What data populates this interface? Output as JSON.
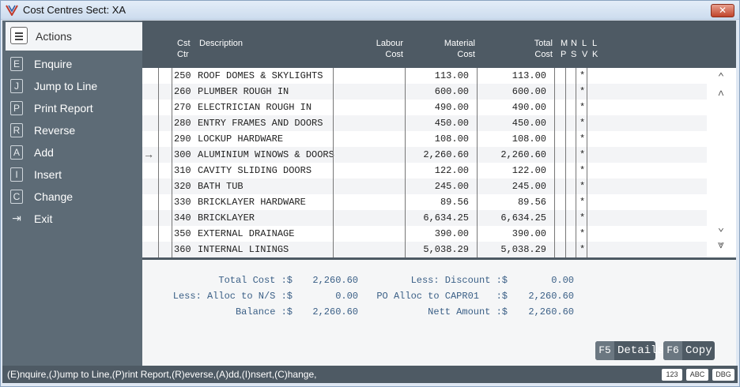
{
  "window": {
    "title": "Cost Centres  Sect: XA",
    "close_label": "✕"
  },
  "sidebar": {
    "title": "Actions",
    "items": [
      {
        "key": "E",
        "label": "Enquire"
      },
      {
        "key": "J",
        "label": "Jump to Line"
      },
      {
        "key": "P",
        "label": "Print Report"
      },
      {
        "key": "R",
        "label": "Reverse"
      },
      {
        "key": "A",
        "label": "Add"
      },
      {
        "key": "I",
        "label": "Insert"
      },
      {
        "key": "C",
        "label": "Change"
      },
      {
        "key": "⇥",
        "label": "Exit"
      }
    ]
  },
  "grid": {
    "headers": {
      "cst_ctr_1": "Cst",
      "cst_ctr_2": "Ctr",
      "description": "Description",
      "labour_1": "Labour",
      "labour_2": "Cost",
      "material_1": "Material",
      "material_2": "Cost",
      "total_1": "Total",
      "total_2": "Cost",
      "mp_1": "M",
      "mp_2": "P",
      "ns_1": "N",
      "ns_2": "S",
      "lv_1": "L",
      "lv_2": "V",
      "lk_1": "L",
      "lk_2": "K"
    },
    "rows": [
      {
        "ctr": "250",
        "desc": "ROOF DOMES & SKYLIGHTS",
        "labour": "",
        "material": "113.00",
        "total": "113.00",
        "lv": "*"
      },
      {
        "ctr": "260",
        "desc": "PLUMBER ROUGH IN",
        "labour": "",
        "material": "600.00",
        "total": "600.00",
        "lv": "*"
      },
      {
        "ctr": "270",
        "desc": "ELECTRICIAN ROUGH IN",
        "labour": "",
        "material": "490.00",
        "total": "490.00",
        "lv": "*"
      },
      {
        "ctr": "280",
        "desc": "ENTRY FRAMES AND DOORS",
        "labour": "",
        "material": "450.00",
        "total": "450.00",
        "lv": "*"
      },
      {
        "ctr": "290",
        "desc": "LOCKUP HARDWARE",
        "labour": "",
        "material": "108.00",
        "total": "108.00",
        "lv": "*"
      },
      {
        "ctr": "300",
        "desc": "ALUMINIUM WINOWS & DOORS",
        "labour": "",
        "material": "2,260.60",
        "total": "2,260.60",
        "lv": "*"
      },
      {
        "ctr": "310",
        "desc": "CAVITY SLIDING DOORS",
        "labour": "",
        "material": "122.00",
        "total": "122.00",
        "lv": "*"
      },
      {
        "ctr": "320",
        "desc": "BATH TUB",
        "labour": "",
        "material": "245.00",
        "total": "245.00",
        "lv": "*"
      },
      {
        "ctr": "330",
        "desc": "BRICKLAYER HARDWARE",
        "labour": "",
        "material": "89.56",
        "total": "89.56",
        "lv": "*"
      },
      {
        "ctr": "340",
        "desc": "BRICKLAYER",
        "labour": "",
        "material": "6,634.25",
        "total": "6,634.25",
        "lv": "*"
      },
      {
        "ctr": "350",
        "desc": "EXTERNAL DRAINAGE",
        "labour": "",
        "material": "390.00",
        "total": "390.00",
        "lv": "*"
      },
      {
        "ctr": "360",
        "desc": "INTERNAL LININGS",
        "labour": "",
        "material": "5,038.29",
        "total": "5,038.29",
        "lv": "*"
      }
    ],
    "current_row_marker": "→"
  },
  "totals": {
    "total_cost_label": "Total Cost :$",
    "total_cost": "2,260.60",
    "alloc_ns_label": "Less: Alloc to N/S :$",
    "alloc_ns": "0.00",
    "balance_label": "Balance :$",
    "balance": "2,260.60",
    "discount_label": "Less: Discount :$",
    "discount": "0.00",
    "po_alloc_label": "PO Alloc to CAPR01   :$",
    "po_alloc": "2,260.60",
    "nett_label": "Nett Amount :$",
    "nett": "2,260.60"
  },
  "buttons": {
    "details_key": "F5",
    "details_label": "Details",
    "copy_key": "F6",
    "copy_label": "Copy"
  },
  "status": {
    "text": "(E)nquire,(J)ump to Line,(P)rint Report,(R)everse,(A)dd,(I)nsert,(C)hange,",
    "badge_123": "123",
    "badge_abc": "ABC",
    "badge_dbg": "DBG"
  },
  "icons": {
    "app": "logo-icon",
    "scroll_top": "double-chevron-up-icon",
    "scroll_up": "chevron-up-icon",
    "scroll_down": "chevron-down-icon",
    "scroll_bottom": "double-chevron-down-icon"
  }
}
